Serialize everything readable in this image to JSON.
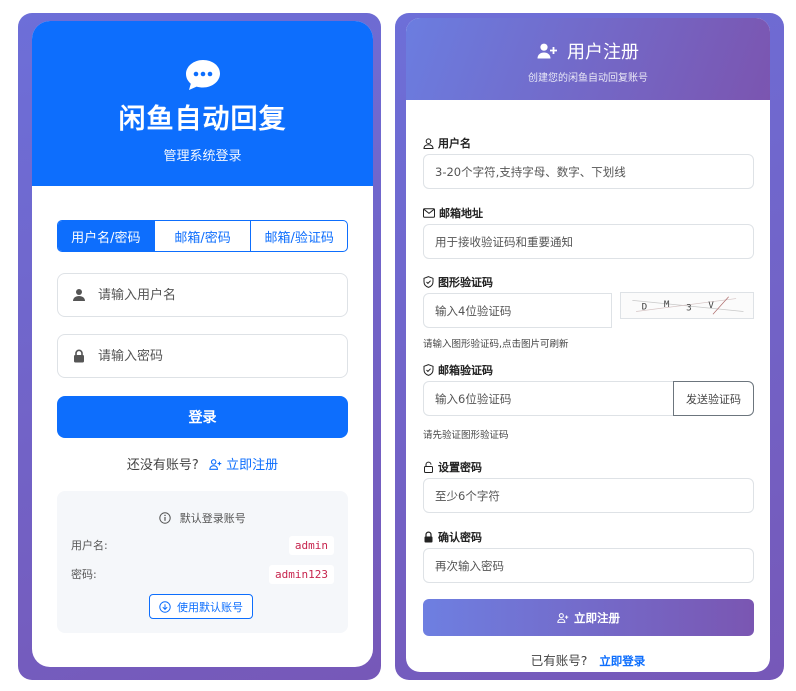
{
  "colors": {
    "primary": "#0d6efd",
    "gradient_start": "#6b7de0",
    "gradient_end": "#7b55b0",
    "code_text": "#c7254e"
  },
  "login": {
    "app_icon": "chat-dots-icon",
    "title": "闲鱼自动回复",
    "subtitle": "管理系统登录",
    "tabs": [
      {
        "label": "用户名/密码",
        "active": true
      },
      {
        "label": "邮箱/密码",
        "active": false
      },
      {
        "label": "邮箱/验证码",
        "active": false
      }
    ],
    "username_placeholder": "请输入用户名",
    "password_placeholder": "请输入密码",
    "login_button": "登录",
    "no_account_text": "还没有账号?",
    "register_link": "立即注册",
    "default_account": {
      "title": "默认登录账号",
      "username_label": "用户名:",
      "username_value": "admin",
      "password_label": "密码:",
      "password_value": "admin123",
      "use_button": "使用默认账号"
    }
  },
  "register": {
    "title": "用户注册",
    "subtitle": "创建您的闲鱼自动回复账号",
    "username": {
      "label": "用户名",
      "placeholder": "3-20个字符,支持字母、数字、下划线"
    },
    "email": {
      "label": "邮箱地址",
      "placeholder": "用于接收验证码和重要通知"
    },
    "captcha": {
      "label": "图形验证码",
      "placeholder": "输入4位验证码",
      "hint": "请输入图形验证码,点击图片可刷新",
      "code_text": "DM3V"
    },
    "email_code": {
      "label": "邮箱验证码",
      "placeholder": "输入6位验证码",
      "send_button": "发送验证码",
      "hint": "请先验证图形验证码"
    },
    "password": {
      "label": "设置密码",
      "placeholder": "至少6个字符"
    },
    "confirm_password": {
      "label": "确认密码",
      "placeholder": "再次输入密码"
    },
    "submit_button": "立即注册",
    "have_account_text": "已有账号?",
    "login_link": "立即登录"
  }
}
